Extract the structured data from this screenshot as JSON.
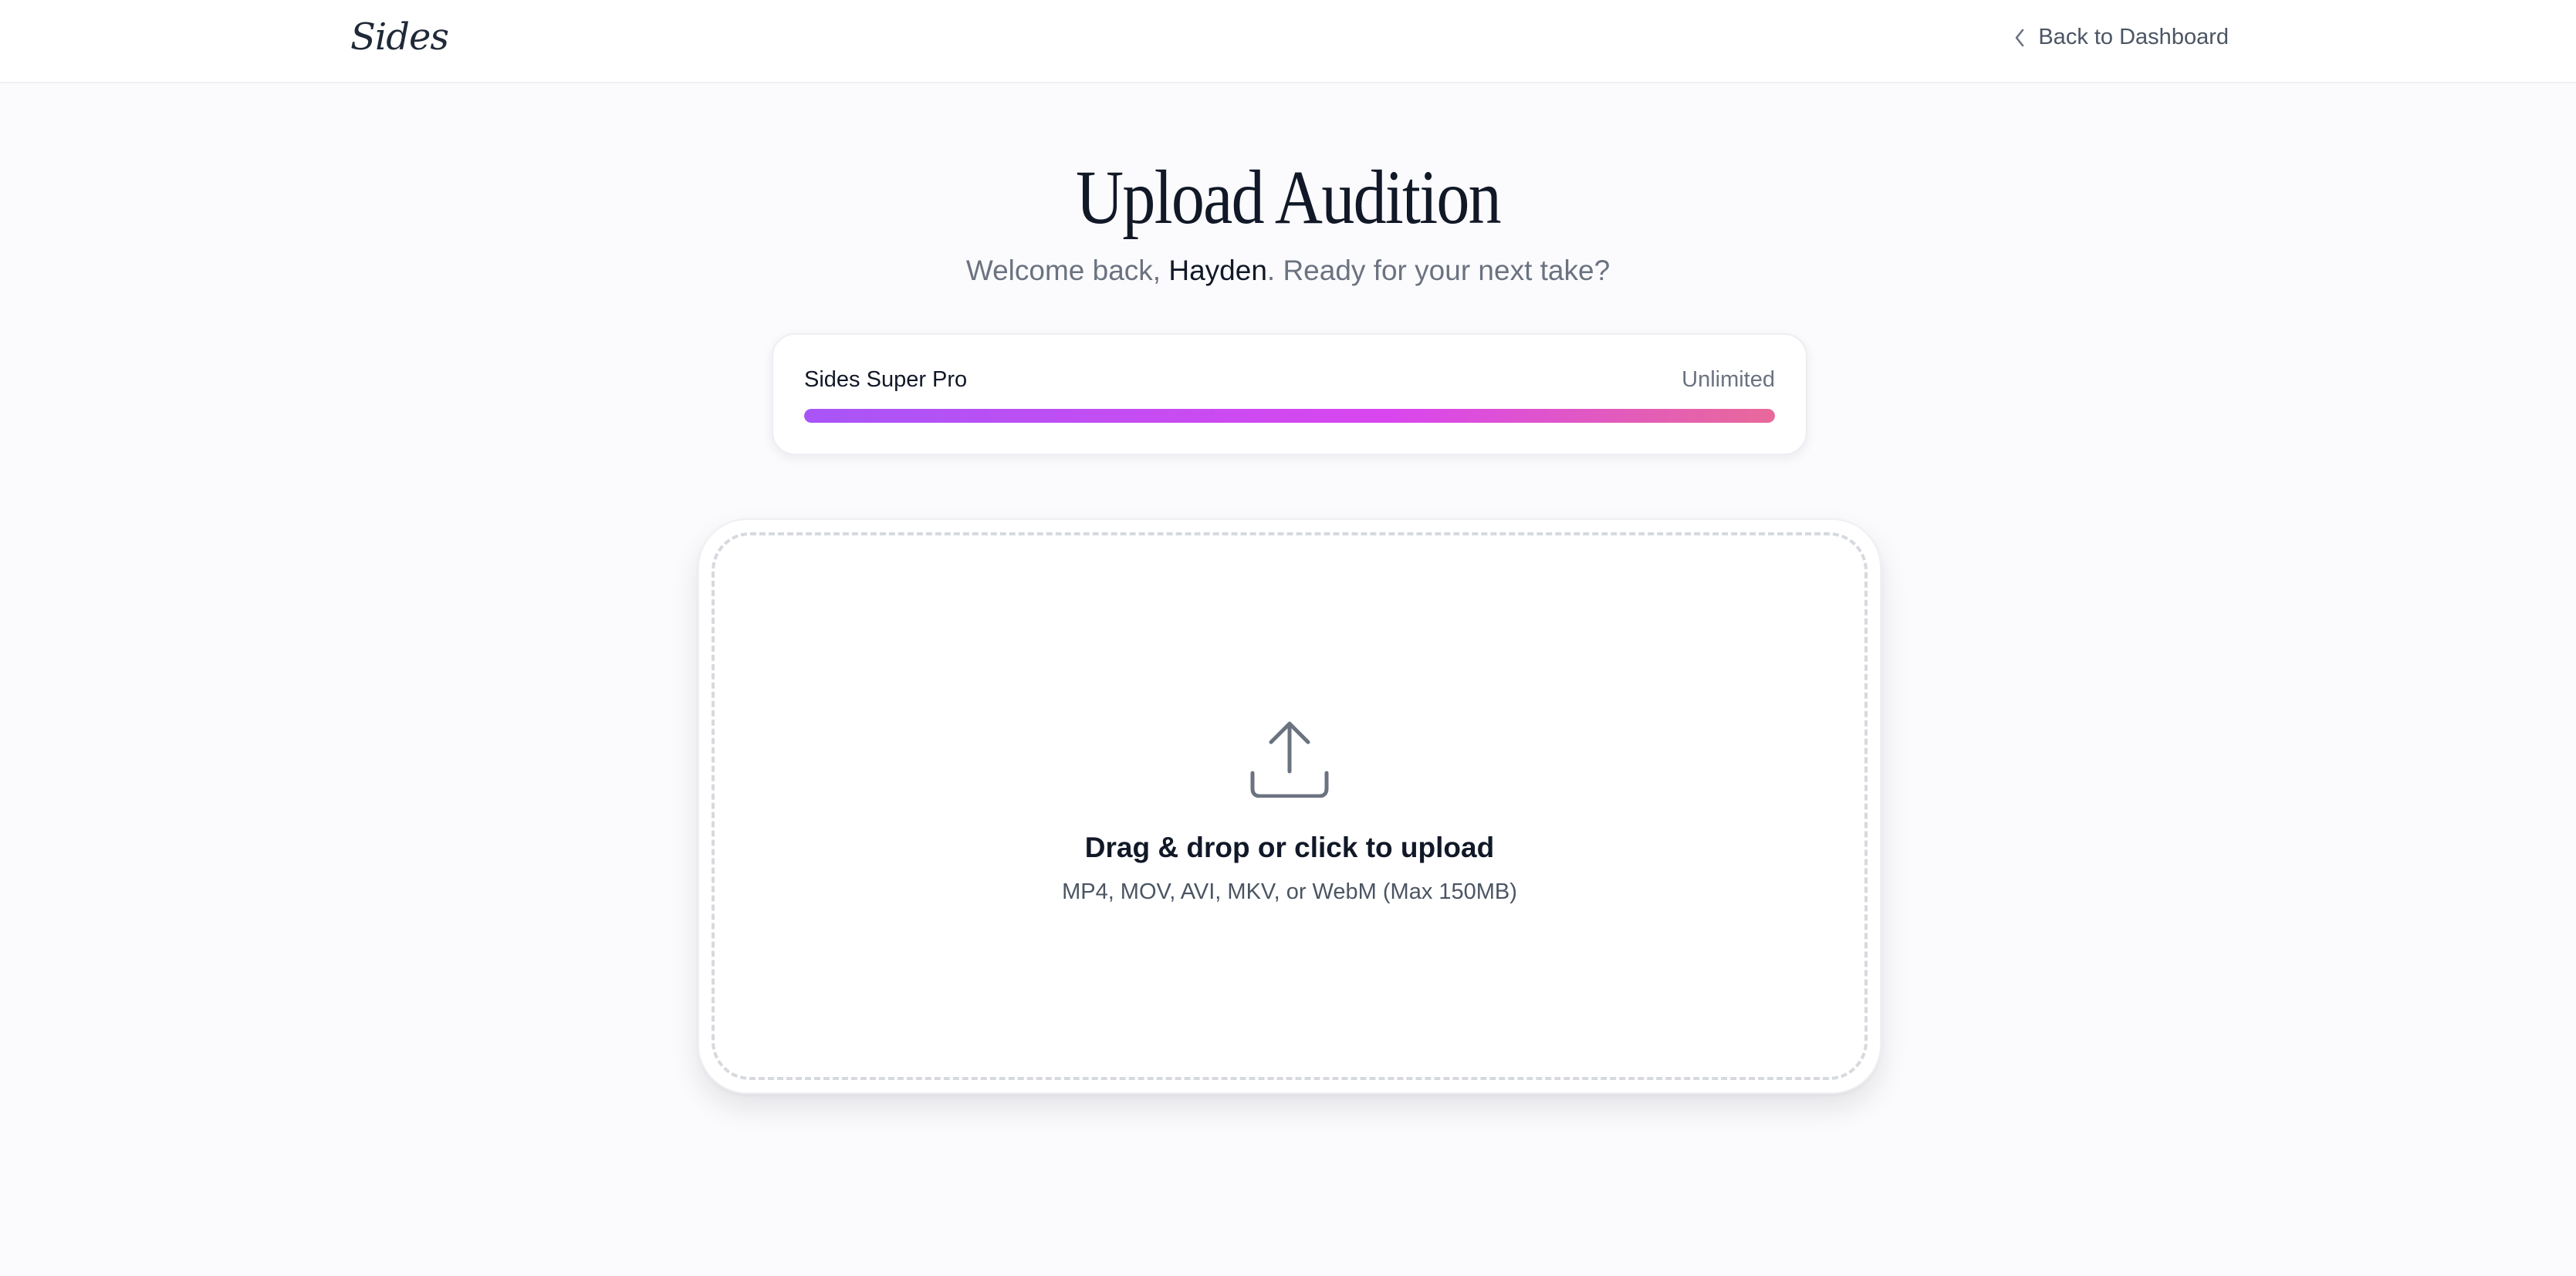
{
  "header": {
    "logo": "Sides",
    "back_label": "Back to Dashboard"
  },
  "main": {
    "title": "Upload Audition",
    "welcome_prefix": "Welcome back, ",
    "user_name": "Hayden",
    "welcome_suffix": ". Ready for your next take?"
  },
  "plan": {
    "name": "Sides Super Pro",
    "limit": "Unlimited",
    "usage_fraction": 1.0,
    "bar_gradient": [
      "#a855f7",
      "#d946ef",
      "#e8699a"
    ]
  },
  "upload": {
    "icon": "upload-icon",
    "title": "Drag & drop or click to upload",
    "subtitle": "MP4, MOV, AVI, MKV, or WebM (Max 150MB)"
  }
}
